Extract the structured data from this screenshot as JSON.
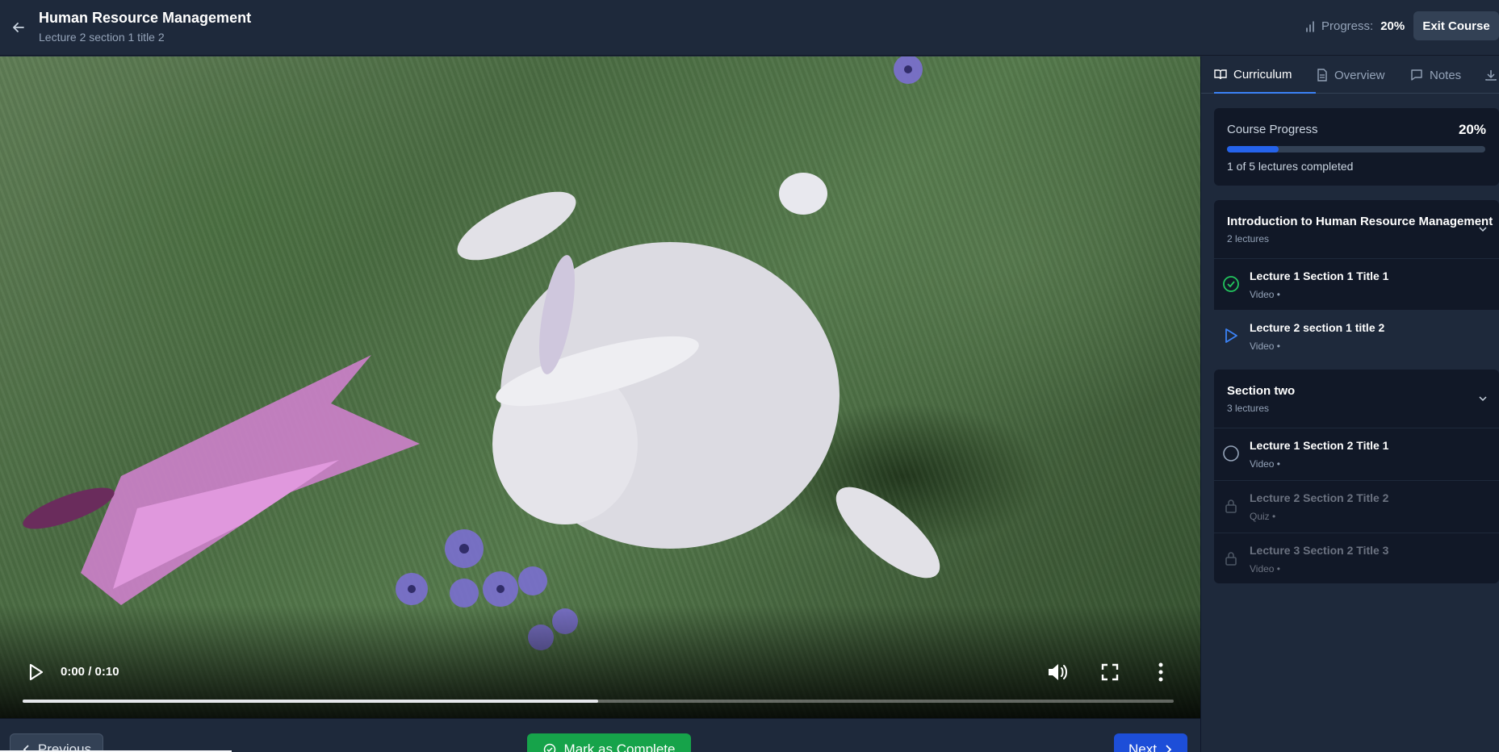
{
  "header": {
    "title": "Human Resource Management",
    "subtitle": "Lecture 2 section 1 title 2",
    "progress_label": "Progress:",
    "progress_value": "20%",
    "exit_label": "Exit Course",
    "icons": {
      "back": "arrow-left-icon",
      "progress": "bar-chart-icon"
    }
  },
  "video": {
    "time_display": "0:00 / 0:10",
    "seek_progress_fraction": 0.5,
    "icons": {
      "play": "play-icon",
      "volume": "volume-icon",
      "fullscreen": "fullscreen-icon",
      "more": "more-vertical-icon"
    }
  },
  "bottom_nav": {
    "previous_label": "Previous",
    "complete_label": "Mark as Complete",
    "next_label": "Next"
  },
  "sidebar": {
    "tabs": [
      {
        "label": "Curriculum",
        "icon": "book-open-icon",
        "active": true
      },
      {
        "label": "Overview",
        "icon": "document-icon",
        "active": false
      },
      {
        "label": "Notes",
        "icon": "message-icon",
        "active": false
      },
      {
        "label": "",
        "icon": "download-icon",
        "active": false
      }
    ],
    "course_progress": {
      "label": "Course Progress",
      "value": "20%",
      "fraction": 0.2,
      "summary": "1 of 5 lectures completed"
    },
    "sections": [
      {
        "title": "Introduction to Human Resource Management",
        "count": "2 lectures",
        "lectures": [
          {
            "title": "Lecture 1 Section 1 Title 1",
            "meta": "Video  •",
            "status": "completed"
          },
          {
            "title": "Lecture 2 section 1 title 2",
            "meta": "Video  •",
            "status": "current"
          }
        ]
      },
      {
        "title": "Section two",
        "count": "3 lectures",
        "lectures": [
          {
            "title": "Lecture 1 Section 2 Title 1",
            "meta": "Video  •",
            "status": "available"
          },
          {
            "title": "Lecture 2 Section 2 Title 2",
            "meta": "Quiz  •",
            "status": "locked"
          },
          {
            "title": "Lecture 3 Section 2 Title 3",
            "meta": "Video  •",
            "status": "locked"
          }
        ]
      }
    ]
  },
  "colors": {
    "background": "#1e293b",
    "panel": "#111827",
    "accent_blue": "#2563eb",
    "complete_green": "#16a34a",
    "completed_check": "#22c55e"
  }
}
